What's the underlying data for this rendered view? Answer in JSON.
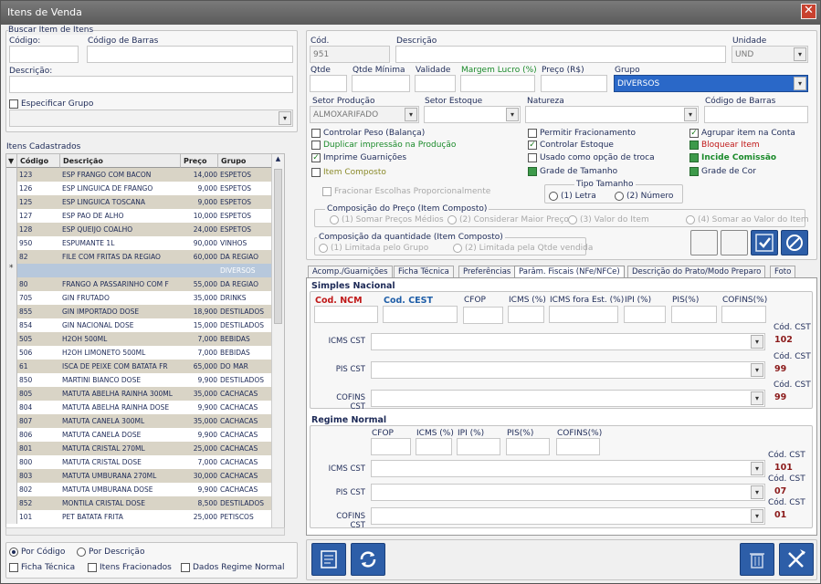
{
  "window": {
    "title": "Itens de Venda"
  },
  "search": {
    "group_title": "Buscar Item de Itens",
    "codigo_label": "Código:",
    "barcode_label": "Código de Barras",
    "descricao_label": "Descrição:",
    "especificar_label": "Especificar Grupo"
  },
  "grid": {
    "title": "Itens Cadastrados",
    "headers": [
      "Código",
      "Descrição",
      "Preço",
      "Grupo"
    ],
    "rows": [
      [
        "123",
        "ESP FRANGO COM BACON",
        "14,000",
        "ESPETOS"
      ],
      [
        "126",
        "ESP LINGUICA DE FRANGO",
        "9,000",
        "ESPETOS"
      ],
      [
        "125",
        "ESP LINGUICA TOSCANA",
        "9,000",
        "ESPETOS"
      ],
      [
        "127",
        "ESP PAO DE ALHO",
        "10,000",
        "ESPETOS"
      ],
      [
        "128",
        "ESP QUEIJO COALHO",
        "24,000",
        "ESPETOS"
      ],
      [
        "950",
        "ESPUMANTE 1L",
        "90,000",
        "VINHOS"
      ],
      [
        "82",
        "FILE COM FRITAS DA REGIAO",
        "60,000",
        "DA REGIAO"
      ],
      [
        "",
        "",
        "",
        "DIVERSOS"
      ],
      [
        "80",
        "FRANGO A PASSARINHO COM F",
        "55,000",
        "DA REGIAO"
      ],
      [
        "705",
        "GIN FRUTADO",
        "35,000",
        "DRINKS"
      ],
      [
        "855",
        "GIN IMPORTADO DOSE",
        "18,900",
        "DESTILADOS"
      ],
      [
        "854",
        "GIN NACIONAL DOSE",
        "15,000",
        "DESTILADOS"
      ],
      [
        "505",
        "H2OH 500ML",
        "7,000",
        "BEBIDAS"
      ],
      [
        "506",
        "H2OH LIMONETO 500ML",
        "7,000",
        "BEBIDAS"
      ],
      [
        "61",
        "ISCA DE PEIXE COM BATATA FR",
        "65,000",
        "DO MAR"
      ],
      [
        "850",
        "MARTINI BIANCO DOSE",
        "9,900",
        "DESTILADOS"
      ],
      [
        "805",
        "MATUTA ABELHA RAINHA 300ML",
        "35,000",
        "CACHACAS"
      ],
      [
        "804",
        "MATUTA ABELHA RAINHA DOSE",
        "9,900",
        "CACHACAS"
      ],
      [
        "807",
        "MATUTA CANELA 300ML",
        "35,000",
        "CACHACAS"
      ],
      [
        "806",
        "MATUTA CANELA DOSE",
        "9,900",
        "CACHACAS"
      ],
      [
        "801",
        "MATUTA CRISTAL 270ML",
        "25,000",
        "CACHACAS"
      ],
      [
        "800",
        "MATUTA CRISTAL DOSE",
        "7,000",
        "CACHACAS"
      ],
      [
        "803",
        "MATUTA UMBURANA 270ML",
        "30,000",
        "CACHACAS"
      ],
      [
        "802",
        "MATUTA UMBURANA DOSE",
        "9,900",
        "CACHACAS"
      ],
      [
        "852",
        "MONTILA CRISTAL DOSE",
        "8,500",
        "DESTILADOS"
      ],
      [
        "101",
        "PET BATATA FRITA",
        "25,000",
        "PETISCOS"
      ]
    ]
  },
  "bottom_left": {
    "por_codigo": "Por Código",
    "por_descricao": "Por Descrição",
    "ficha_tecnica": "Ficha Técnica",
    "itens_fracionados": "Itens Fracionados",
    "dados_regime": "Dados Regime Normal"
  },
  "item": {
    "cod_label": "Cód.",
    "cod_value": "951",
    "descricao_label": "Descrição",
    "unidade_label": "Unidade",
    "unidade_value": "UND",
    "qtde_label": "Qtde",
    "qtde_min_label": "Qtde Mínima",
    "validade_label": "Validade",
    "margem_label": "Margem Lucro (%)",
    "preco_label": "Preço (R$)",
    "grupo_label": "Grupo",
    "grupo_value": "DIVERSOS",
    "setor_prod_label": "Setor Produção",
    "setor_prod_value": "ALMOXARIFADO",
    "setor_est_label": "Setor Estoque",
    "natureza_label": "Natureza",
    "barcode_label": "Código de Barras"
  },
  "checks": {
    "controlar_peso": "Controlar Peso (Balança)",
    "duplicar": "Duplicar impressão na Produção",
    "imprime_guarnicoes": "Imprime Guarnições",
    "item_composto": "Item Composto",
    "permitir_fracionamento": "Permitir Fracionamento",
    "controlar_estoque": "Controlar Estoque",
    "usado_troca": "Usado como opção de troca",
    "grade_tamanho": "Grade de Tamanho",
    "agrupar": "Agrupar item na Conta",
    "bloquear": "Bloquear Item",
    "incide_comissao": "Incide Comissão",
    "grade_cor": "Grade de Cor",
    "fracionar_escolhas": "Fracionar Escolhas Proporcionalmente"
  },
  "tipo_tamanho": {
    "title": "Tipo Tamanho",
    "letra": "(1) Letra",
    "numero": "(2) Número"
  },
  "comp_preco": {
    "title": "Composição do Preço (Item Composto)",
    "opt1": "(1) Somar Preços Médios",
    "opt2": "(2) Considerar Maior Preço",
    "opt3": "(3) Valor do Item",
    "opt4": "(4) Somar ao Valor do Item"
  },
  "comp_qtde": {
    "title": "Composição da quantidade (Item Composto)",
    "opt1": "(1) Limitada pelo Grupo",
    "opt2": "(2) Limitada pela Qtde vendida"
  },
  "tabs": [
    "Acomp./Guarnições",
    "Ficha Técnica",
    "Preferências",
    "Parâm. Fiscais (NFe/NFCe)",
    "Descrição do Prato/Modo Preparo",
    "Foto"
  ],
  "simples": {
    "title": "Simples Nacional",
    "ncm": "Cod. NCM",
    "cest": "Cod. CEST",
    "cfop": "CFOP",
    "icms": "ICMS (%)",
    "icms_fora": "ICMS fora Est. (%)",
    "ipi": "IPI (%)",
    "pis": "PIS(%)",
    "cofins": "COFINS(%)",
    "icms_cst": "ICMS CST",
    "pis_cst": "PIS CST",
    "cofins_cst": "COFINS CST",
    "cod_cst": "Cód. CST",
    "icms_cst_val": "102",
    "pis_cst_val": "99",
    "cofins_cst_val": "99"
  },
  "regime": {
    "title": "Regime Normal",
    "cfop": "CFOP",
    "icms": "ICMS (%)",
    "ipi": "IPI (%)",
    "pis": "PIS(%)",
    "cofins": "COFINS(%)",
    "icms_cst": "ICMS CST",
    "pis_cst": "PIS CST",
    "cofins_cst": "COFINS CST",
    "cod_cst": "Cód. CST",
    "icms_cst_val": "101",
    "pis_cst_val": "07",
    "cofins_cst_val": "01"
  }
}
